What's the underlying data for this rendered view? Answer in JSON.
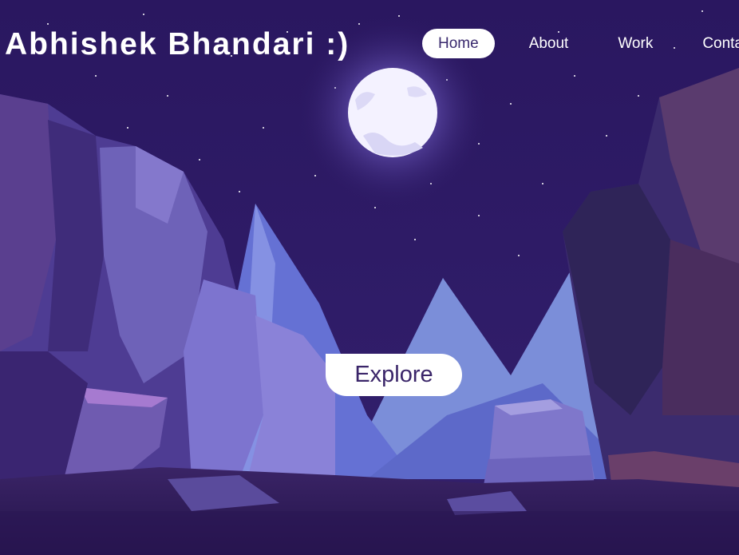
{
  "header": {
    "title": "Abhishek Bhandari :)"
  },
  "nav": {
    "items": [
      {
        "label": "Home",
        "active": true
      },
      {
        "label": "About",
        "active": false
      },
      {
        "label": "Work",
        "active": false
      },
      {
        "label": "Contact",
        "active": false
      }
    ]
  },
  "hero": {
    "cta_label": "Explore"
  },
  "colors": {
    "sky": "#2d1a63",
    "accent_text": "#3a2569",
    "moon": "#f4f2ff",
    "mountain_light": "#7b8ed9",
    "mountain_mid": "#5e63c9",
    "rock_light": "#7c6fc6",
    "rock_dark": "#2b1f52"
  }
}
